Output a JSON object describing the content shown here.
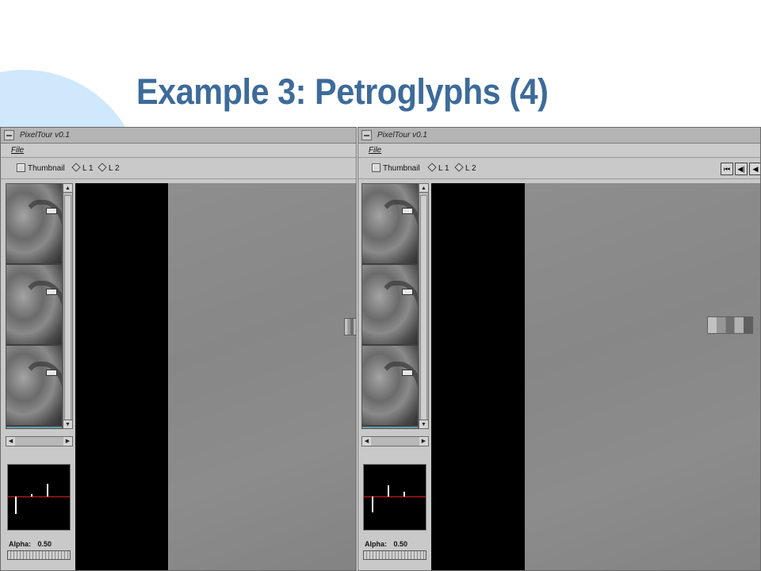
{
  "slide": {
    "title": "Example 3: Petroglyphs (4)"
  },
  "windows": [
    {
      "title": "PixelTour v0.1",
      "menu": {
        "file_label": "File"
      },
      "options": {
        "thumbnail_label": "Thumbnail",
        "layer1_label": "L 1",
        "layer2_label": "L 2"
      },
      "alpha": {
        "label": "Alpha:",
        "value": "0.50",
        "fraction": 0.5
      }
    },
    {
      "title": "PixelTour v0.1",
      "menu": {
        "file_label": "File"
      },
      "options": {
        "thumbnail_label": "Thumbnail",
        "layer1_label": "L 1",
        "layer2_label": "L 2"
      },
      "transport": {
        "first_icon": "skip-to-start-icon",
        "prev_icon": "step-back-icon",
        "play_back_icon": "play-reverse-icon"
      },
      "alpha": {
        "label": "Alpha:",
        "value": "0.50",
        "fraction": 0.5
      }
    }
  ],
  "colors": {
    "title": "#3d6b9a",
    "decor_circle": "#cfe8fb",
    "histogram_line": "#e02020"
  }
}
